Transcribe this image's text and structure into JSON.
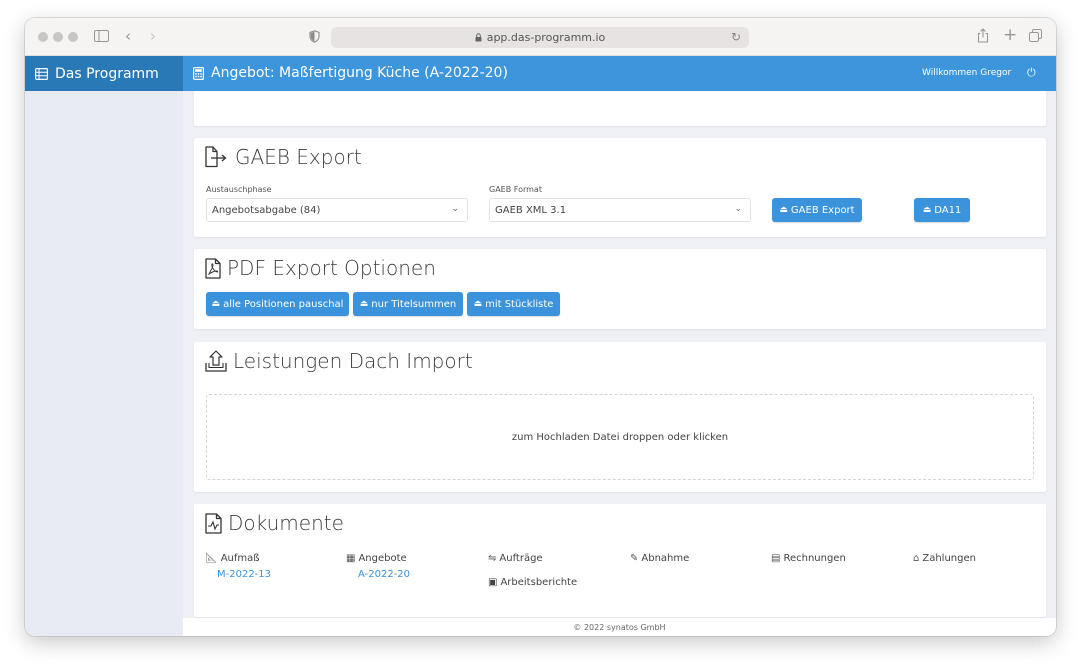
{
  "browser": {
    "url": "app.das-programm.io"
  },
  "app": {
    "name": "Das Programm",
    "page_title": "Angebot: Maßfertigung Küche (A-2022-20)",
    "welcome": "Willkommen Gregor"
  },
  "gaeb": {
    "title": "GAEB Export",
    "phase_label": "Austauschphase",
    "phase_value": "Angebotsabgabe (84)",
    "format_label": "GAEB Format",
    "format_value": "GAEB XML 3.1",
    "export_button": "GAEB Export",
    "da11_button": "DA11"
  },
  "pdf": {
    "title": "PDF Export Optionen",
    "buttons": [
      "alle Positionen pauschal",
      "nur Titelsummen",
      "mit Stückliste"
    ]
  },
  "import": {
    "title": "Leistungen Dach Import",
    "dropzone_text": "zum Hochladen Datei droppen oder klicken"
  },
  "documents": {
    "title": "Dokumente",
    "columns": [
      {
        "label": "Aufmaß",
        "link": "M-2022-13",
        "icon": "ruler-icon"
      },
      {
        "label": "Angebote",
        "link": "A-2022-20",
        "icon": "calculator-icon"
      },
      {
        "label": "Aufträge",
        "icon": "handshake-icon",
        "sub_label": "Arbeitsberichte",
        "sub_icon": "id-card-icon"
      },
      {
        "label": "Abnahme",
        "icon": "signature-icon"
      },
      {
        "label": "Rechnungen",
        "icon": "invoice-icon"
      },
      {
        "label": "Zahlungen",
        "icon": "bank-icon"
      }
    ]
  },
  "footer": {
    "text": "© 2022 synatos GmbH"
  },
  "colors": {
    "sidebar_header": "#2a79b7",
    "topbar": "#3d95db",
    "button": "#3a93db",
    "sidebar_bg": "#e8ebf3",
    "content_bg": "#eef0f6"
  }
}
